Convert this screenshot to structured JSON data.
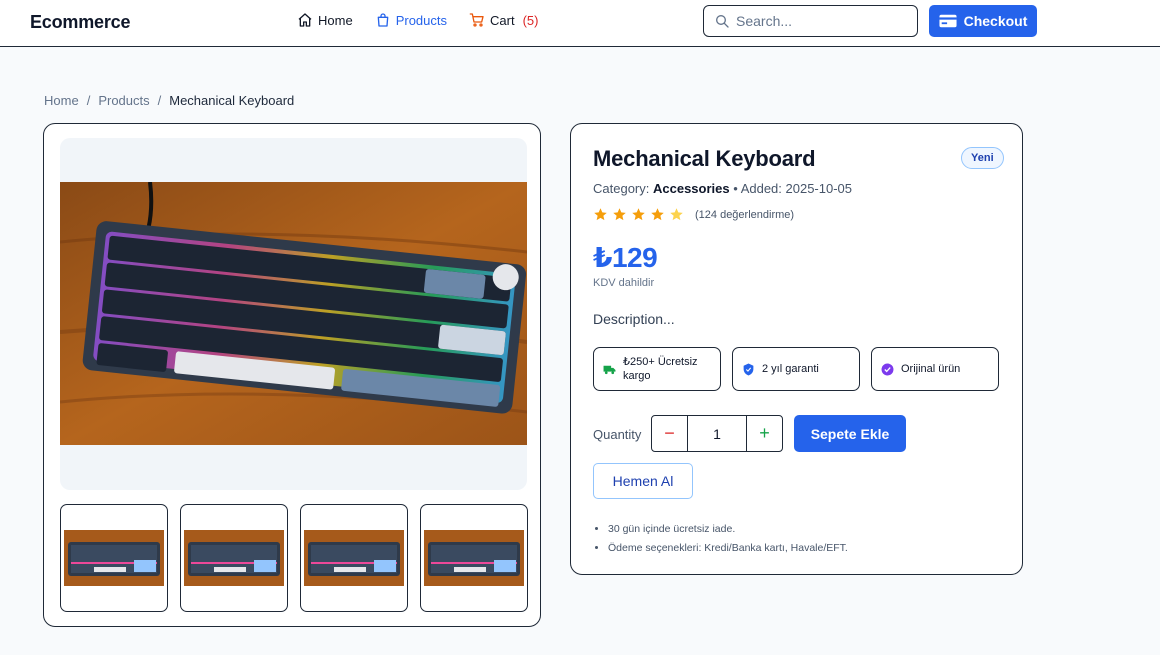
{
  "header": {
    "brand": "Ecommerce",
    "nav": [
      {
        "label": "Home",
        "icon": "home-icon"
      },
      {
        "label": "Products",
        "icon": "bag-icon",
        "active": true
      },
      {
        "label": "Cart",
        "icon": "cart-icon",
        "count": "(5)"
      }
    ],
    "search_placeholder": "Search...",
    "checkout_label": "Checkout"
  },
  "breadcrumb": {
    "items": [
      "Home",
      "Products",
      "Mechanical Keyboard"
    ],
    "separator": "/"
  },
  "product": {
    "title": "Mechanical Keyboard",
    "badge": "Yeni",
    "category_prefix": "Category:",
    "category": "Accessories",
    "added": "• Added: 2025-10-05",
    "rating": 4,
    "rating_max": 5,
    "rating_count": "(124 değerlendirme)",
    "price": "₺129",
    "vat_note": "KDV dahildir",
    "description": "Description...",
    "features": [
      {
        "label": "₺250+ Ücretsiz kargo",
        "icon": "truck-icon",
        "color": "#16a34a"
      },
      {
        "label": "2 yıl garanti",
        "icon": "shield-icon",
        "color": "#2563eb"
      },
      {
        "label": "Orijinal ürün",
        "icon": "verified-icon",
        "color": "#7c3aed"
      }
    ],
    "quantity_label": "Quantity",
    "quantity": "1",
    "add_to_cart": "Sepete Ekle",
    "buy_now": "Hemen Al",
    "notes": [
      "30 gün içinde ücretsiz iade.",
      "Ödeme seçenekleri: Kredi/Banka kartı, Havale/EFT."
    ]
  },
  "colors": {
    "accent": "#2563eb",
    "star": "#f59e0b",
    "star_empty": "#fcd34d"
  }
}
